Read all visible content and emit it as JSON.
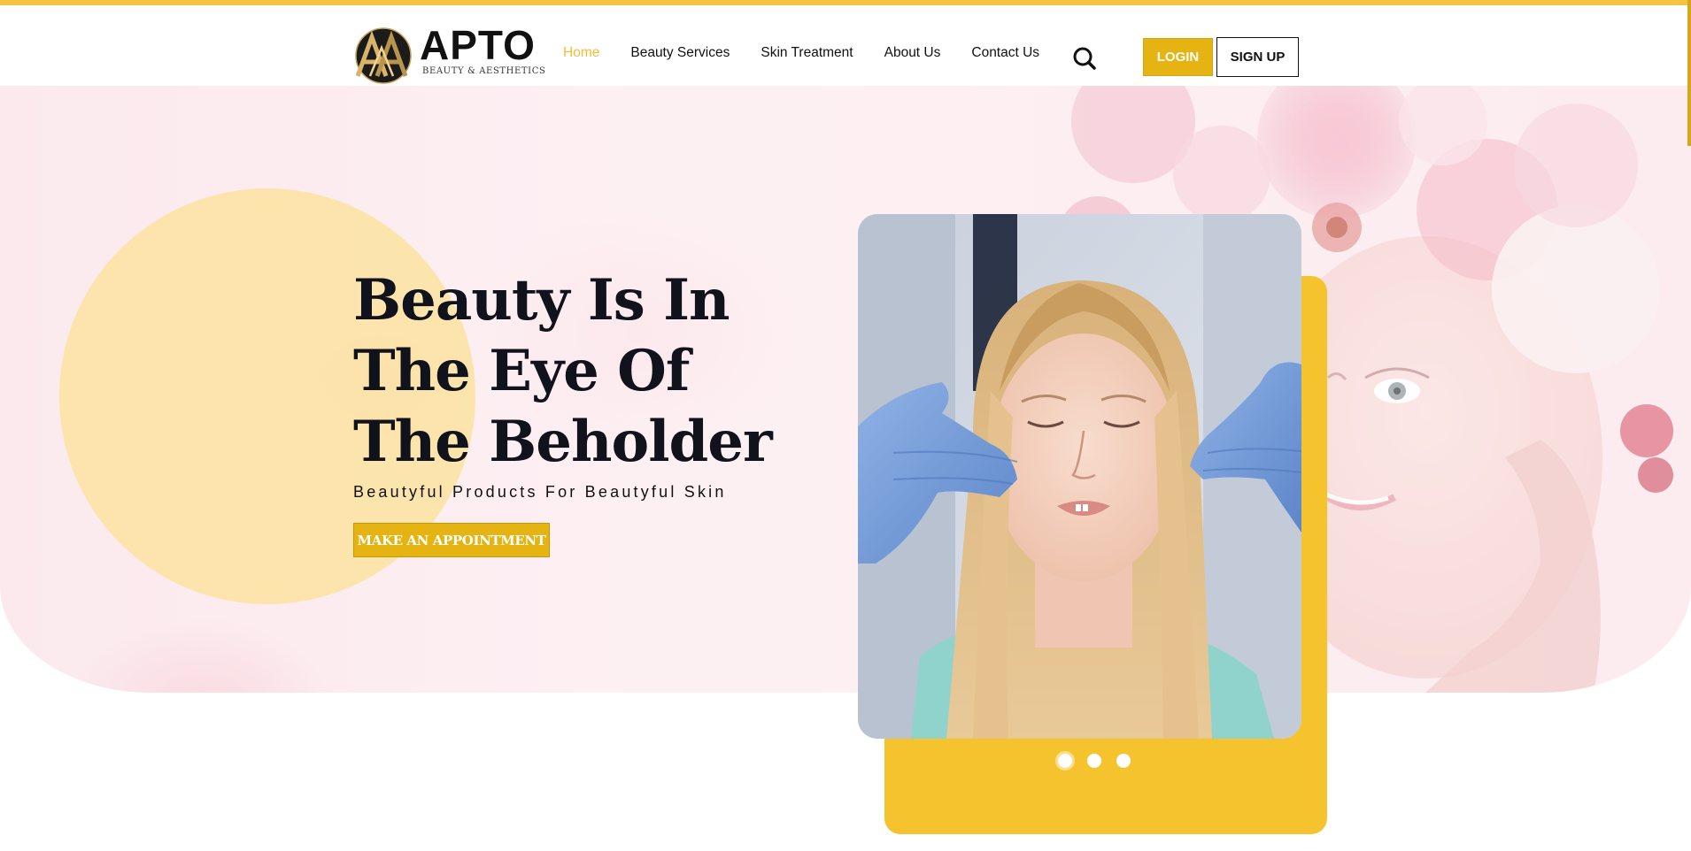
{
  "brand": {
    "name": "APTO",
    "tagline": "BEAUTY & AESTHETICS",
    "accent_color": "#f5c242"
  },
  "nav": {
    "items": [
      {
        "label": "Home",
        "active": true
      },
      {
        "label": "Beauty Services",
        "active": false
      },
      {
        "label": "Skin Treatment",
        "active": false
      },
      {
        "label": "About Us",
        "active": false
      },
      {
        "label": "Contact Us",
        "active": false
      }
    ],
    "search_icon": "search-icon",
    "login_label": "LOGIN",
    "signup_label": "SIGN UP"
  },
  "hero": {
    "title": "Beauty Is In\nThe Eye Of\nThe Beholder",
    "subtitle": "Beautyful Products For Beautyful Skin",
    "cta_label": "MAKE AN APPOINTMENT"
  },
  "slider": {
    "slide_count": 3,
    "active_index": 0
  }
}
